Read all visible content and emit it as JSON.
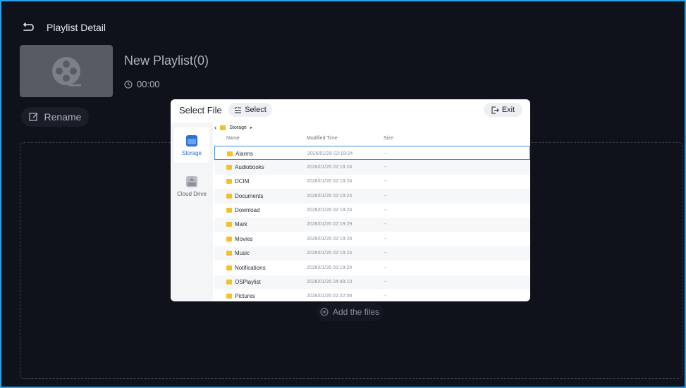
{
  "header": {
    "title": "Playlist Detail"
  },
  "playlist": {
    "name": "New Playlist(0)",
    "duration": "00:00"
  },
  "rename_label": "Rename",
  "add_files_label": "Add the files",
  "dialog": {
    "title": "Select File",
    "select_label": "Select",
    "exit_label": "Exit",
    "sources": [
      {
        "label": "Storage",
        "icon": "storage-icon",
        "active": true
      },
      {
        "label": "Cloud Drive",
        "icon": "cloud-drive-icon",
        "active": false
      }
    ],
    "breadcrumb": [
      "Storage"
    ],
    "columns": [
      "Name",
      "Modified Time",
      "Size"
    ],
    "rows": [
      {
        "name": "Alarms",
        "time": "2026/01/26 02:19:24",
        "size": "--"
      },
      {
        "name": "Audiobooks",
        "time": "2026/01/26 02:19:24",
        "size": "--"
      },
      {
        "name": "DCIM",
        "time": "2026/01/26 02:19:24",
        "size": "--"
      },
      {
        "name": "Documents",
        "time": "2026/01/26 02:19:24",
        "size": "--"
      },
      {
        "name": "Download",
        "time": "2026/01/26 02:19:24",
        "size": "--"
      },
      {
        "name": "Mark",
        "time": "2026/01/26 02:19:29",
        "size": "--"
      },
      {
        "name": "Movies",
        "time": "2026/01/26 02:19:24",
        "size": "--"
      },
      {
        "name": "Music",
        "time": "2026/01/26 02:19:24",
        "size": "--"
      },
      {
        "name": "Notifications",
        "time": "2026/01/26 02:19:24",
        "size": "--"
      },
      {
        "name": "OSPlaylist",
        "time": "2026/01/26 04:49:10",
        "size": "--"
      },
      {
        "name": "Pictures",
        "time": "2026/01/26 02:22:06",
        "size": "--"
      }
    ]
  },
  "colors": {
    "accent": "#2b6fd8",
    "folder": "#f4c028",
    "background": "#0f121b",
    "selection": "#3b8fd8"
  }
}
